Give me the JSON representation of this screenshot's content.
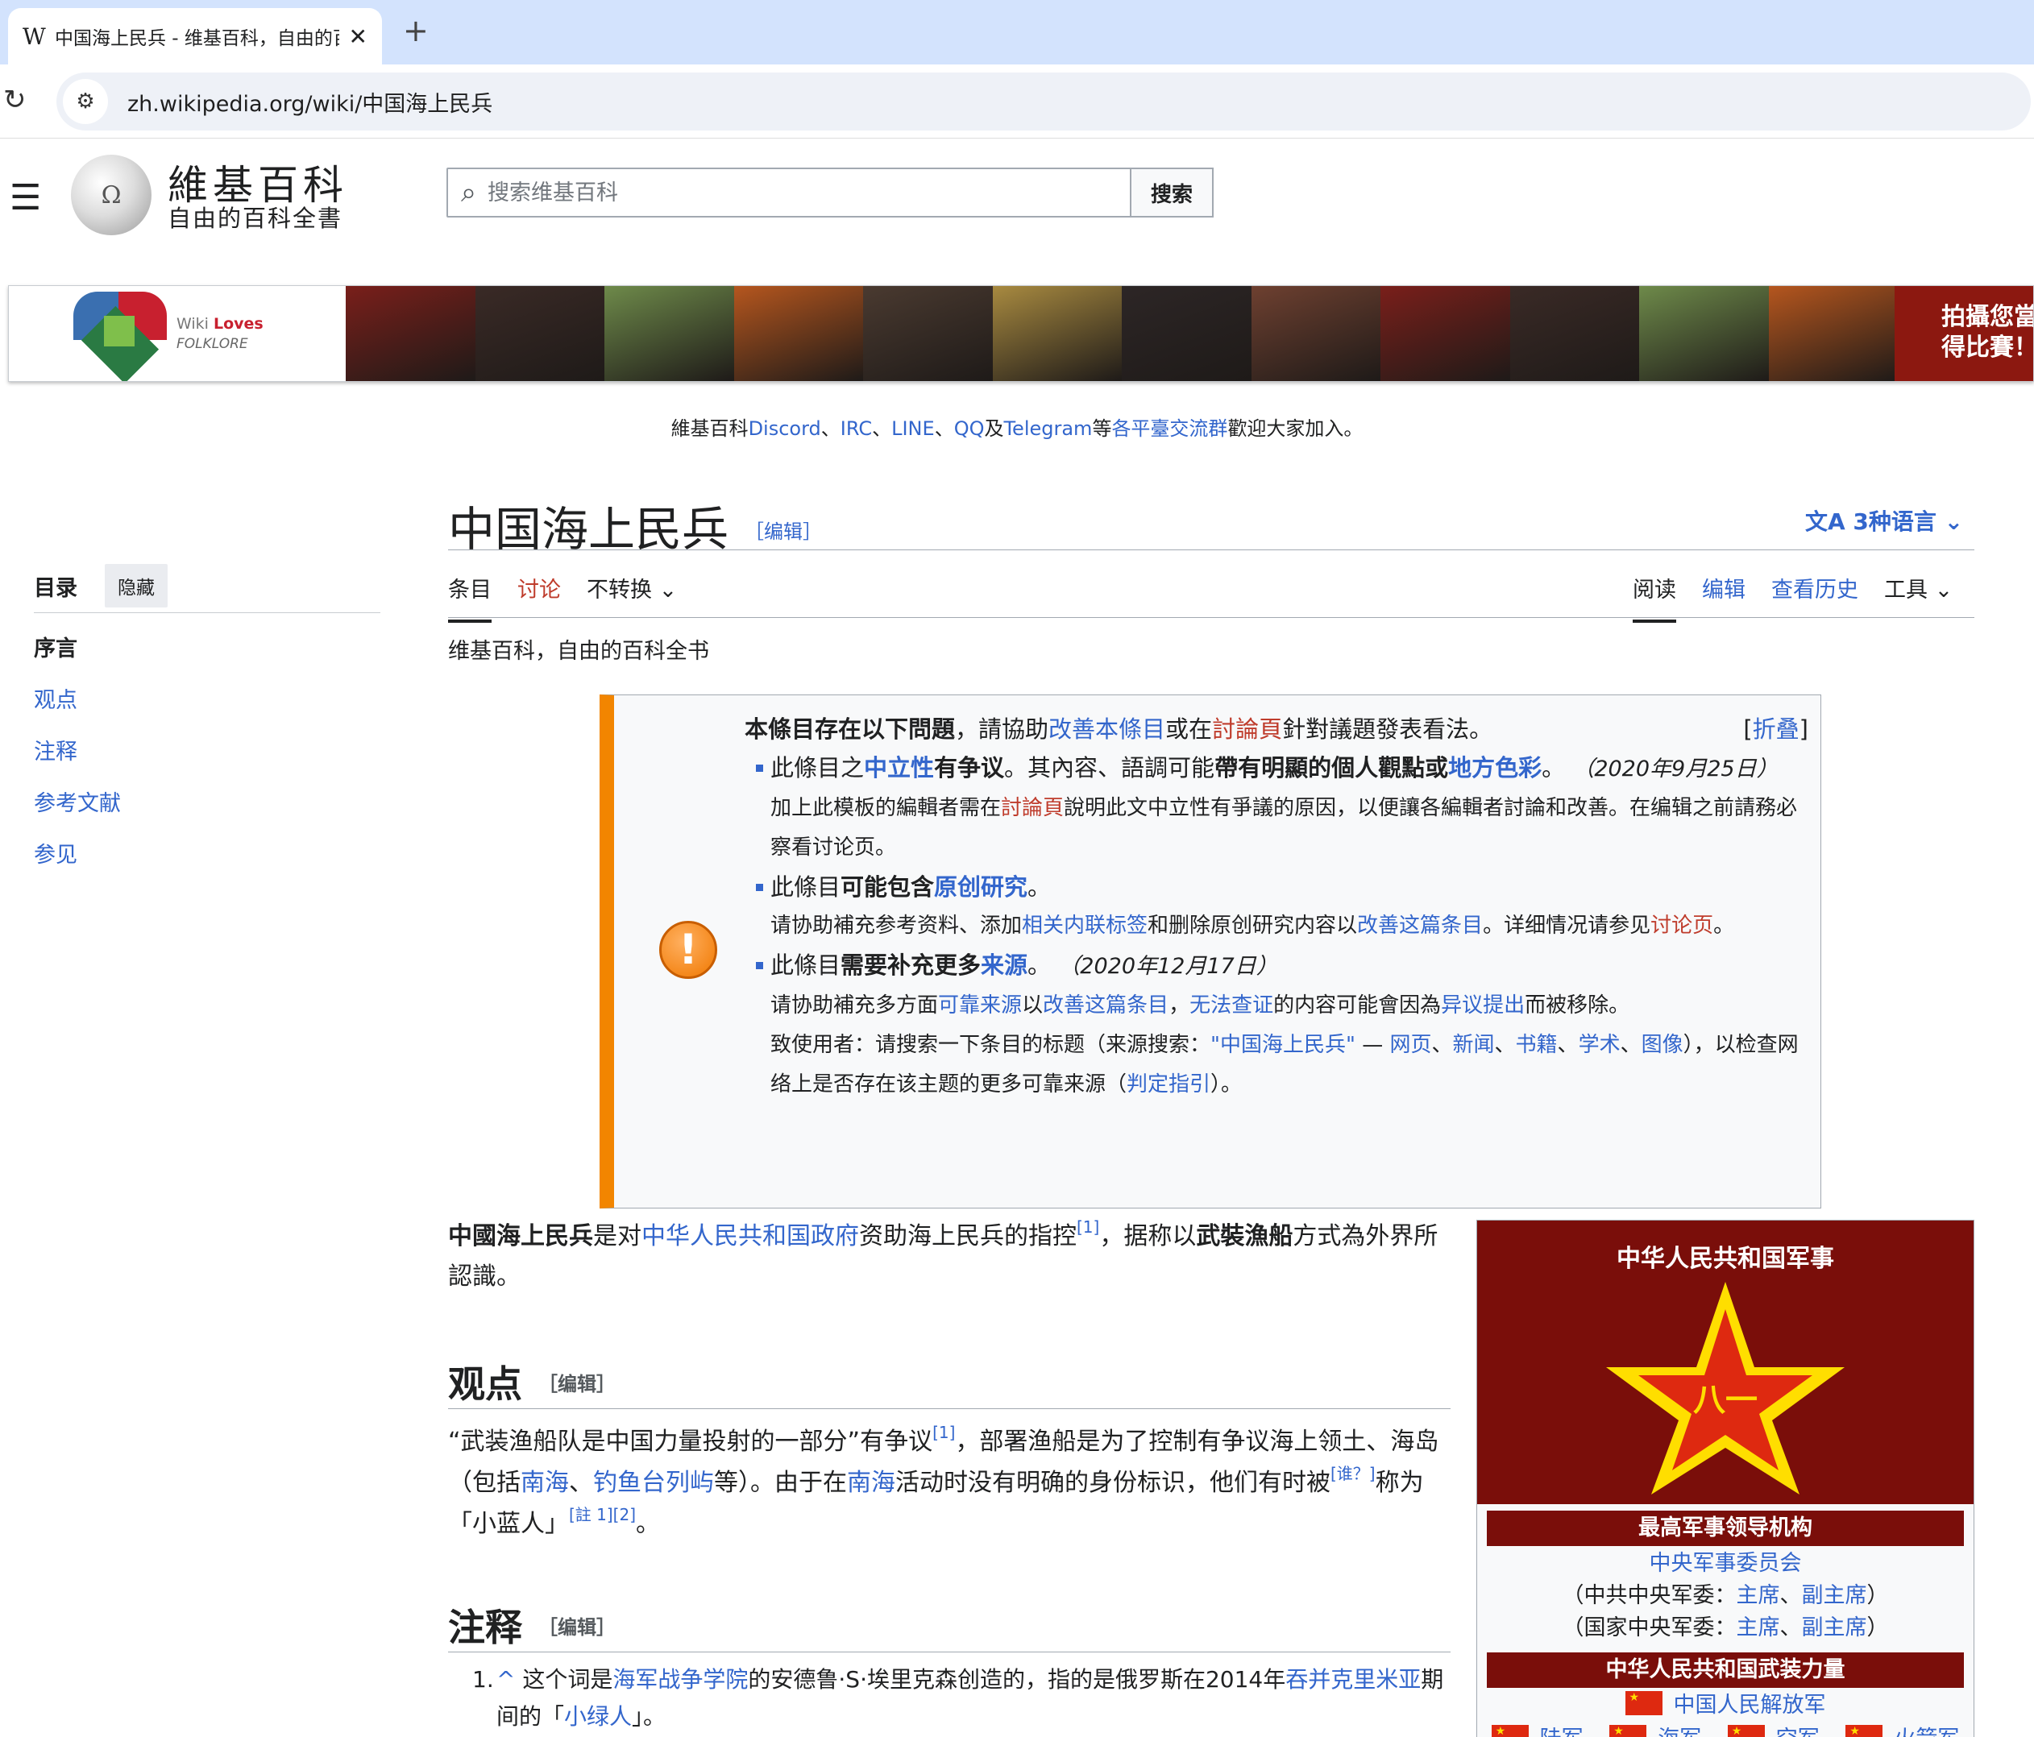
{
  "browser": {
    "tab_title": "中国海上民兵 - 维基百科，自由的百科全书",
    "tab_favicon": "W",
    "new_tab": "+",
    "url": "zh.wikipedia.org/wiki/中国海上民兵"
  },
  "header": {
    "logo_title": "維基百科",
    "logo_subtitle": "自由的百科全書",
    "search_placeholder": "搜索维基百科",
    "search_button": "搜索"
  },
  "banner": {
    "wiki": "Wiki",
    "loves": "Loves",
    "folklore": "FOLKLORE",
    "cta_line1": "拍攝您當",
    "cta_line2": "得比賽！",
    "photo_colors": [
      "#7a1f1a",
      "#3a2a26",
      "#6e8a4a",
      "#b5561e",
      "#4a3a30",
      "#a88a40",
      "#2d2626",
      "#6e4030",
      "#7a1f1a",
      "#3a2a26",
      "#6e8a4a",
      "#b5561e"
    ]
  },
  "sitenotice": {
    "prefix": "維基百科",
    "discord": "Discord",
    "sep1": "、",
    "irc": "IRC",
    "sep2": "、",
    "line": "LINE",
    "sep3": "、",
    "qq": "QQ",
    "and": "及",
    "telegram": "Telegram",
    "mid": "等",
    "groups": "各平臺交流群",
    "suffix": "歡迎大家加入。"
  },
  "title": {
    "text": "中国海上民兵",
    "edit": "［编辑］",
    "languages": "3种语言"
  },
  "tabs": {
    "article": "条目",
    "talk": "讨论",
    "variant": "不转换",
    "read": "阅读",
    "edit": "编辑",
    "history": "查看历史",
    "tools": "工具"
  },
  "toc": {
    "title": "目录",
    "hide": "隐藏",
    "items": [
      "序言",
      "观点",
      "注释",
      "参考文献",
      "参见"
    ]
  },
  "tagline": "维基百科，自由的百科全书",
  "ambox": {
    "header_a": "本條目存在以下問題",
    "header_b": "，請協助",
    "header_link1": "改善本條目",
    "header_c": "或在",
    "header_link2": "討論頁",
    "header_d": "針對議題發表看法。",
    "collapse_open": "[",
    "collapse": "折叠",
    "collapse_close": "]",
    "i1_a": "此條目之",
    "i1_link": "中立性",
    "i1_b": "有争议",
    "i1_c": "。其內容、語調可能",
    "i1_d": "帶有明顯的個人觀點或",
    "i1_link2": "地方色彩",
    "i1_e": "。",
    "i1_date": "（2020年9月25日）",
    "i1_sub_a": "加上此模板的編輯者需在",
    "i1_sub_link": "討論頁",
    "i1_sub_b": "說明此文中立性有爭議的原因，以便讓各編輯者討論和改善。在编辑之前請務必察看讨论页。",
    "i2_a": "此條目",
    "i2_b": "可能包含",
    "i2_link": "原创研究",
    "i2_c": "。",
    "i2_sub_a": "请协助補充参考资料、添加",
    "i2_sub_link1": "相关内联标签",
    "i2_sub_b": "和删除原创研究内容以",
    "i2_sub_link2": "改善这篇条目",
    "i2_sub_c": "。详细情况请参见",
    "i2_sub_link3": "讨论页",
    "i2_sub_d": "。",
    "i3_a": "此條目",
    "i3_b": "需要补充更多",
    "i3_link": "来源",
    "i3_c": "。",
    "i3_date": "（2020年12月17日）",
    "i3_sub_a": "请协助補充多方面",
    "i3_sub_link1": "可靠来源",
    "i3_sub_b": "以",
    "i3_sub_link2": "改善这篇条目",
    "i3_sub_c": "，",
    "i3_sub_link3": "无法查证",
    "i3_sub_d": "的内容可能會因為",
    "i3_sub_link4": "异议提出",
    "i3_sub_e": "而被移除。",
    "i3_note_a": "致使用者：请搜索一下条目的标题（来源搜索：",
    "i3_note_q": "\"中国海上民兵\"",
    "i3_note_dash": " — ",
    "i3_note_web": "网页",
    "i3_note_s1": "、",
    "i3_note_news": "新闻",
    "i3_note_s2": "、",
    "i3_note_books": "书籍",
    "i3_note_s3": "、",
    "i3_note_scholar": "学术",
    "i3_note_s4": "、",
    "i3_note_images": "图像",
    "i3_note_b": "），以检查网络上是否存在该主题的更多可靠来源（",
    "i3_note_link": "判定指引",
    "i3_note_c": "）。"
  },
  "lead": {
    "bold1": "中國海上民兵",
    "a": "是对",
    "link1": "中华人民共和国政府",
    "b": "资助海上民兵的指控",
    "ref1": "[1]",
    "c": "，据称以",
    "bold2": "武裝漁船",
    "d": "方式為外界所認識。"
  },
  "views": {
    "heading": "观点",
    "edit": "［编辑］",
    "a": "“武装渔船队是中国力量投射的一部分”有争议",
    "ref1": "[1]",
    "b": "，部署渔船是为了控制有争议海上领土、海岛（包括",
    "link1": "南海",
    "c": "、",
    "link2": "钓鱼台列屿",
    "d": "等）。由于在",
    "link3": "南海",
    "e": "活动时没有明确的身份标识，他们有时被",
    "who": "[谁？]",
    "f": "称为 「小蓝人」",
    "ref2": "[註 1][2]",
    "g": "。"
  },
  "notes": {
    "heading": "注释",
    "edit": "［编辑］",
    "n1_num": "1.",
    "n1_caret": "^",
    "n1_a": " 这个词是",
    "n1_link1": "海军战争学院",
    "n1_b": "的安德鲁·S·埃里克森创造的，指的是俄罗斯在2014年",
    "n1_link2": "吞并克里米亚",
    "n1_c": "期间的「",
    "n1_link3": "小绿人",
    "n1_d": "」。"
  },
  "infobox": {
    "title": "中华人民共和国军事",
    "emblem": "八一",
    "bar1": "最高军事领导机构",
    "cmc": "中央军事委员会",
    "party_a": "（中共中央军委：",
    "party_l1": "主席",
    "party_s": "、",
    "party_l2": "副主席",
    "party_b": "）",
    "state_a": "（国家中央军委：",
    "state_l1": "主席",
    "state_s": "、",
    "state_l2": "副主席",
    "state_b": "）",
    "bar2": "中华人民共和国武装力量",
    "pla": "中国人民解放军",
    "branches": [
      "陆军",
      "海军",
      "空军",
      "火箭军"
    ]
  }
}
